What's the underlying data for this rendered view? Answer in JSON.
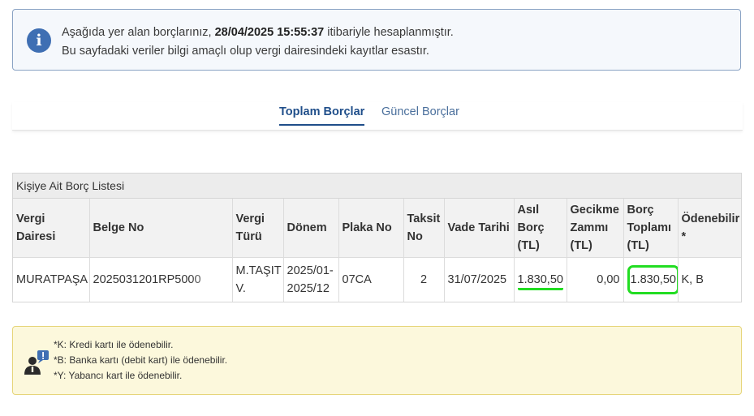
{
  "info": {
    "line1_prefix": "Aşağıda yer alan borçlarınız,",
    "line1_date": "28/04/2025 15:55:37",
    "line1_suffix": "itibariyle hesaplanmıştır.",
    "line2": "Bu sayfadaki veriler bilgi amaçlı olup vergi dairesindeki kayıtlar esastır.",
    "icon": "info-icon"
  },
  "tabs": [
    {
      "label": "Toplam Borçlar",
      "active": true
    },
    {
      "label": "Güncel Borçlar",
      "active": false
    }
  ],
  "table": {
    "caption": "Kişiye Ait Borç Listesi",
    "headers": [
      "Vergi Dairesi",
      "Belge No",
      "Vergi Türü",
      "Dönem",
      "Plaka No",
      "Taksit No",
      "Vade Tarihi",
      "Asıl Borç (TL)",
      "Gecikme Zammı (TL)",
      "Borç Toplamı (TL)",
      "Ödenebilir *"
    ],
    "rows": [
      {
        "vergi_dairesi": "MURATPAŞA",
        "belge_no": "2025031201RP5000",
        "vergi_turu": "M.TAŞIT V.",
        "donem": "2025/01-2025/12",
        "plaka_no": "07CA",
        "taksit_no": "2",
        "vade_tarihi": "31/07/2025",
        "asil_borc": "1.830,50",
        "gecikme_zammi": "0,00",
        "borc_toplami": "1.830,50",
        "odenebilir": "K, B"
      }
    ]
  },
  "notes": {
    "icon": "speaker-alert-icon",
    "lines": [
      "*K: Kredi kartı ile ödenebilir.",
      "*B: Banka kartı (debit kart) ile ödenebilir.",
      "*Y: Yabancı kart ile ödenebilir."
    ]
  },
  "colors": {
    "accent": "#1f4e8a",
    "info_icon": "#3f6fb3",
    "highlight": "#22dd22",
    "note_bg": "#fcf8dc"
  }
}
